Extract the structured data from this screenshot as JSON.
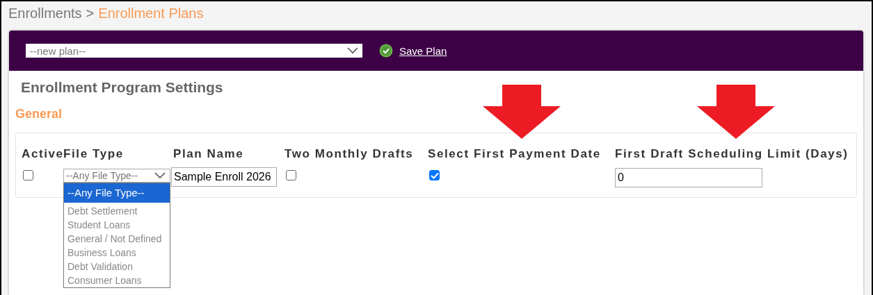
{
  "breadcrumb": {
    "items": [
      {
        "label": "Enrollments",
        "current": false
      },
      {
        "label": "Enrollment Plans",
        "current": true
      }
    ],
    "separator": ">"
  },
  "toolbar": {
    "plan_select": {
      "value": "--new plan--"
    },
    "save_button": {
      "label": "Save Plan"
    }
  },
  "settings": {
    "title": "Enrollment Program Settings",
    "section": "General",
    "columns": [
      {
        "label": "Active",
        "highlighted": false
      },
      {
        "label": "File Type",
        "highlighted": false
      },
      {
        "label": "Plan Name",
        "highlighted": false
      },
      {
        "label": "Two Monthly Drafts",
        "highlighted": false
      },
      {
        "label": "Select First Payment Date",
        "highlighted": true
      },
      {
        "label": "First Draft Scheduling Limit (Days)",
        "highlighted": true
      }
    ],
    "row": [
      {
        "kind": "checkbox",
        "checked": false
      },
      {
        "kind": "select",
        "value": "--Any File Type--",
        "expanded": true,
        "options": [
          {
            "label": "--Any File Type--",
            "selected": true
          },
          {
            "label": "Debt Settlement",
            "selected": false
          },
          {
            "label": "Student Loans",
            "selected": false
          },
          {
            "label": "General / Not Defined",
            "selected": false
          },
          {
            "label": "Business Loans",
            "selected": false
          },
          {
            "label": "Debt Validation",
            "selected": false
          },
          {
            "label": "Consumer Loans",
            "selected": false
          }
        ]
      },
      {
        "kind": "text",
        "value": "Sample Enroll 2026"
      },
      {
        "kind": "checkbox",
        "checked": false
      },
      {
        "kind": "checkbox",
        "checked": true
      },
      {
        "kind": "text",
        "value": "0"
      }
    ]
  }
}
